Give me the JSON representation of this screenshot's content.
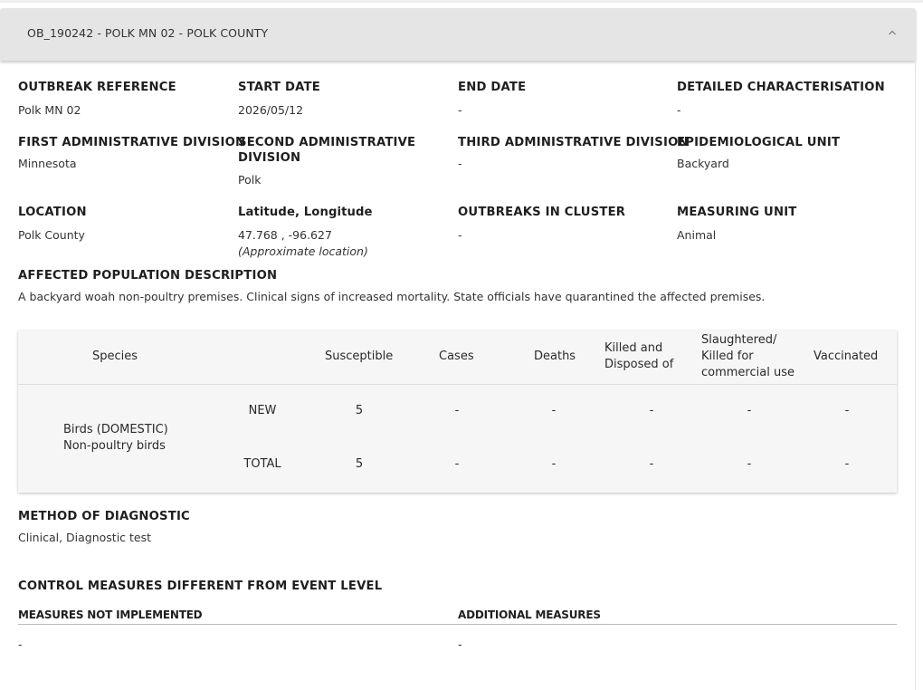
{
  "header": {
    "title": "OB_190242 - POLK MN 02 - POLK COUNTY"
  },
  "fields": {
    "outbreak_reference": {
      "label": "OUTBREAK REFERENCE",
      "value": "Polk MN 02"
    },
    "start_date": {
      "label": "START DATE",
      "value": "2026/05/12"
    },
    "end_date": {
      "label": "END DATE",
      "value": "-"
    },
    "detailed_characterisation": {
      "label": "DETAILED CHARACTERISATION",
      "value": "-"
    },
    "first_admin_division": {
      "label": "FIRST ADMINISTRATIVE DIVISION",
      "value": "Minnesota"
    },
    "second_admin_division": {
      "label_line1": "SECOND ADMINISTRATIVE",
      "label_line2": "DIVISION",
      "value": "Polk"
    },
    "third_admin_division": {
      "label": "THIRD ADMINISTRATIVE DIVISION",
      "value": "-"
    },
    "epidemiological_unit": {
      "label": "EPIDEMIOLOGICAL UNIT",
      "value": "Backyard"
    },
    "location": {
      "label": "LOCATION",
      "value": "Polk County"
    },
    "lat_long": {
      "label": "Latitude, Longitude",
      "value": "47.768 , -96.627",
      "note": "(Approximate location)"
    },
    "outbreaks_in_cluster": {
      "label": "OUTBREAKS IN CLUSTER",
      "value": "-"
    },
    "measuring_unit": {
      "label": "MEASURING UNIT",
      "value": "Animal"
    }
  },
  "affected_population": {
    "label": "AFFECTED POPULATION DESCRIPTION",
    "value": "A backyard woah non-poultry premises. Clinical signs of increased mortality. State officials have quarantined the affected premises."
  },
  "table": {
    "headers": {
      "species": "Species",
      "susceptible": "Susceptible",
      "cases": "Cases",
      "deaths": "Deaths",
      "killed_line1": "Killed and",
      "killed_line2": "Disposed of",
      "slaughtered_line1": "Slaughtered/",
      "slaughtered_line2": "Killed for",
      "slaughtered_line3": "commercial use",
      "vaccinated": "Vaccinated"
    },
    "species_line1": "Birds (DOMESTIC)",
    "species_line2": "Non-poultry birds",
    "rows": [
      {
        "type": "NEW",
        "susceptible": "5",
        "cases": "-",
        "deaths": "-",
        "killed": "-",
        "slaughtered": "-",
        "vaccinated": "-"
      },
      {
        "type": "TOTAL",
        "susceptible": "5",
        "cases": "-",
        "deaths": "-",
        "killed": "-",
        "slaughtered": "-",
        "vaccinated": "-"
      }
    ]
  },
  "method_of_diagnostic": {
    "label": "METHOD OF DIAGNOSTIC",
    "value": "Clinical, Diagnostic test"
  },
  "control_measures": {
    "label": "CONTROL MEASURES DIFFERENT FROM EVENT LEVEL",
    "not_implemented_label": "MEASURES NOT IMPLEMENTED",
    "not_implemented_value": "-",
    "additional_label": "ADDITIONAL MEASURES",
    "additional_value": "-"
  },
  "icons": {
    "collapse": "chevron-up-icon"
  }
}
